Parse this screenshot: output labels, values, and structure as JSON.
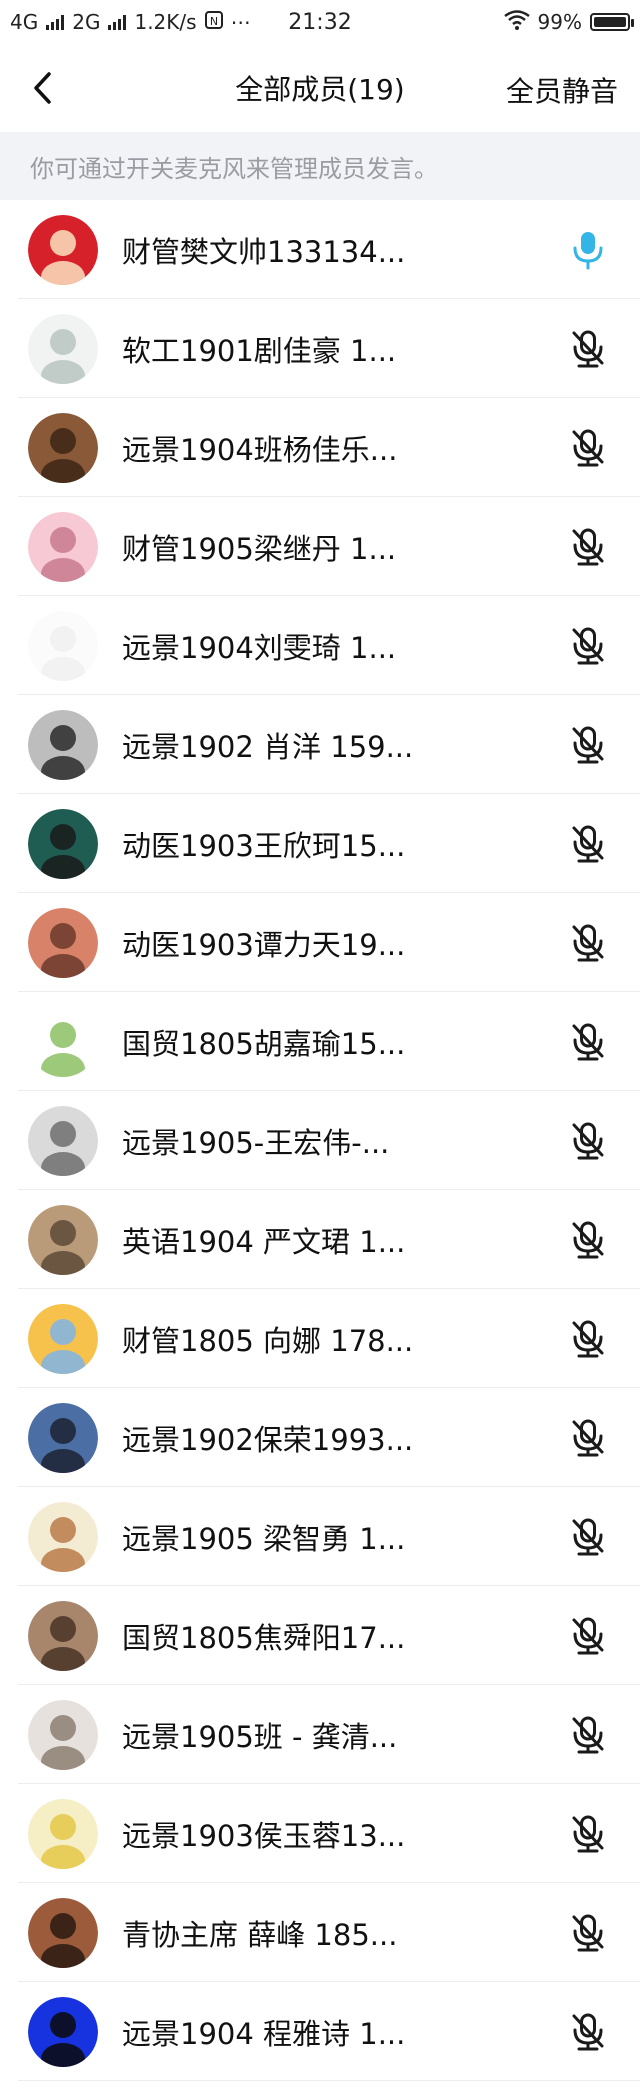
{
  "status_bar": {
    "network1": "4G",
    "network2": "2G",
    "speed": "1.2K/s",
    "extra_icons": "⋯",
    "time": "21:32",
    "battery": "99%",
    "battery_level": 0.99
  },
  "header": {
    "title": "全部成员(19)",
    "mute_all": "全员静音"
  },
  "notice": "你可通过开关麦克风来管理成员发言。",
  "colors": {
    "accent": "#33b5e5",
    "muted_icon": "#1a1a1a"
  },
  "members": [
    {
      "name": "财管樊文帅133134...",
      "mic": "on",
      "avatar": {
        "bg": "#d6202a",
        "fg": "#fbe3c0"
      }
    },
    {
      "name": "软工1901剧佳豪  1...",
      "mic": "off",
      "avatar": {
        "bg": "#f1f3f2",
        "fg": "#b9c4c2"
      }
    },
    {
      "name": "远景1904班杨佳乐...",
      "mic": "off",
      "avatar": {
        "bg": "#8a5a38",
        "fg": "#3b2615"
      }
    },
    {
      "name": "财管1905梁继丹 1...",
      "mic": "off",
      "avatar": {
        "bg": "#f7c9d4",
        "fg": "#c97a8e"
      }
    },
    {
      "name": "远景1904刘雯琦 1...",
      "mic": "off",
      "avatar": {
        "bg": "#fbfbfb",
        "fg": "#f0f0f0"
      }
    },
    {
      "name": "远景1902 肖洋 159...",
      "mic": "off",
      "avatar": {
        "bg": "#bdbdbd",
        "fg": "#2b2b2b"
      }
    },
    {
      "name": "动医1903王欣珂15...",
      "mic": "off",
      "avatar": {
        "bg": "#1f5c52",
        "fg": "#1a1a1a"
      }
    },
    {
      "name": "动医1903谭力天19...",
      "mic": "off",
      "avatar": {
        "bg": "#d8826a",
        "fg": "#6b3a2c"
      }
    },
    {
      "name": "国贸1805胡嘉瑜15...",
      "mic": "off",
      "avatar": {
        "bg": "#ffffff",
        "fg": "#8cc063"
      }
    },
    {
      "name": "远景1905-王宏伟-...",
      "mic": "off",
      "avatar": {
        "bg": "#dadada",
        "fg": "#6e6e6e"
      }
    },
    {
      "name": "英语1904 严文珺 1...",
      "mic": "off",
      "avatar": {
        "bg": "#b99a79",
        "fg": "#5d4a38"
      }
    },
    {
      "name": "财管1805 向娜 178...",
      "mic": "off",
      "avatar": {
        "bg": "#f6c24c",
        "fg": "#7fb5e8"
      }
    },
    {
      "name": "远景1902保荣1993...",
      "mic": "off",
      "avatar": {
        "bg": "#4b6fa5",
        "fg": "#1c2333"
      }
    },
    {
      "name": "远景1905 梁智勇 1...",
      "mic": "off",
      "avatar": {
        "bg": "#f4ecd2",
        "fg": "#b97b4a"
      }
    },
    {
      "name": "国贸1805焦舜阳17...",
      "mic": "off",
      "avatar": {
        "bg": "#a7866b",
        "fg": "#4a3426"
      }
    },
    {
      "name": "远景1905班 - 龚清...",
      "mic": "off",
      "avatar": {
        "bg": "#e6e1dc",
        "fg": "#8c7e72"
      }
    },
    {
      "name": "远景1903侯玉蓉13...",
      "mic": "off",
      "avatar": {
        "bg": "#f6eec5",
        "fg": "#e4c846"
      }
    },
    {
      "name": "青协主席 薛峰 185...",
      "mic": "off",
      "avatar": {
        "bg": "#9c5b3a",
        "fg": "#2a1a12"
      }
    },
    {
      "name": "远景1904 程雅诗 1...",
      "mic": "off",
      "avatar": {
        "bg": "#1733e0",
        "fg": "#0a0a0a"
      }
    }
  ]
}
